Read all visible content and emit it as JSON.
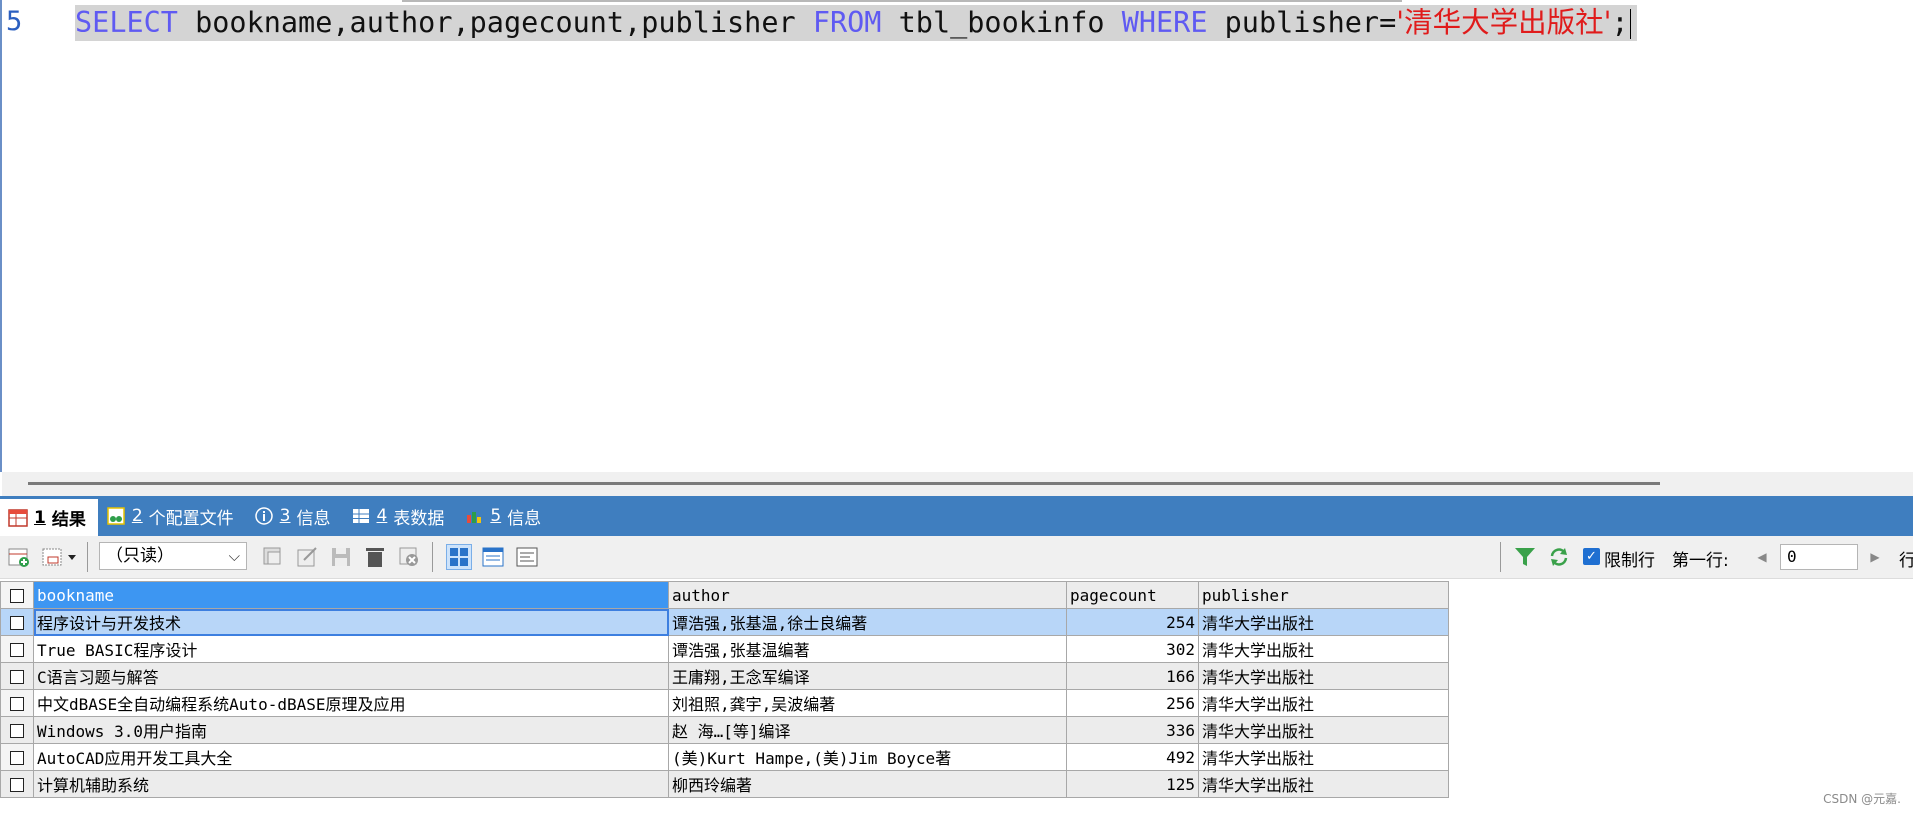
{
  "editor": {
    "line_number": "5",
    "sql": {
      "kw_select": "SELECT",
      "columns": " bookname,author,pagecount,publisher ",
      "kw_from": "FROM",
      "table": " tbl_bookinfo ",
      "kw_where": "WHERE",
      "condition": " publisher=",
      "string_value": "'清华大学出版社'",
      "terminator": ";"
    }
  },
  "tabs": [
    {
      "num": "1",
      "label": "结果",
      "icon": "result-grid-icon",
      "active": true
    },
    {
      "num": "2",
      "label": "个配置文件",
      "icon": "profile-icon"
    },
    {
      "num": "3",
      "label": "信息",
      "icon": "info-icon"
    },
    {
      "num": "4",
      "label": "表数据",
      "icon": "table-data-icon"
    },
    {
      "num": "5",
      "label": "信息",
      "icon": "info-history-icon"
    }
  ],
  "toolbar": {
    "mode_select": {
      "value": "（只读）"
    },
    "limit_rows": {
      "label": "限制行",
      "checked": true
    },
    "first_row": {
      "label": "第一行:",
      "value": "0"
    },
    "row_count_label": "行"
  },
  "grid": {
    "columns": [
      "bookname",
      "author",
      "pagecount",
      "publisher"
    ],
    "rows": [
      [
        "程序设计与开发技术",
        "谭浩强,张基温,徐士良编著",
        "254",
        "清华大学出版社"
      ],
      [
        "True BASIC程序设计",
        "谭浩强,张基温编著",
        "302",
        "清华大学出版社"
      ],
      [
        "C语言习题与解答",
        "王庸翔,王念军编译",
        "166",
        "清华大学出版社"
      ],
      [
        "中文dBASE全自动编程系统Auto-dBASE原理及应用",
        "刘祖照,龚宇,吴波编著",
        "256",
        "清华大学出版社"
      ],
      [
        "Windows 3.0用户指南",
        "赵 海…[等]编译",
        "336",
        "清华大学出版社"
      ],
      [
        "AutoCAD应用开发工具大全",
        "(美)Kurt Hampe,(美)Jim Boyce著",
        "492",
        "清华大学出版社"
      ],
      [
        "计算机辅助系统",
        "柳西玲编著",
        "125",
        "清华大学出版社"
      ]
    ]
  },
  "watermark": "CSDN @元嘉."
}
